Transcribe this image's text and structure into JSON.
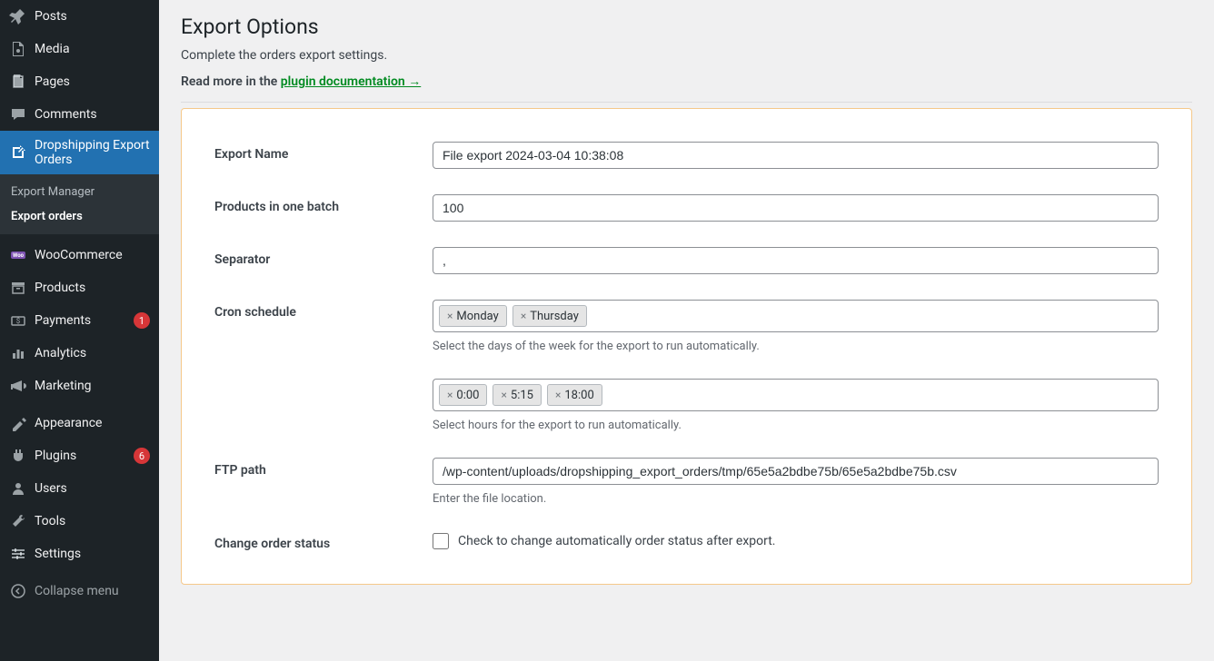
{
  "sidebar": {
    "items": [
      {
        "label": "Posts",
        "icon": "pushpin"
      },
      {
        "label": "Media",
        "icon": "media"
      },
      {
        "label": "Pages",
        "icon": "pages"
      },
      {
        "label": "Comments",
        "icon": "comments"
      },
      {
        "label": "Dropshipping Export Orders",
        "icon": "export",
        "active": true
      },
      {
        "label": "WooCommerce",
        "icon": "woo"
      },
      {
        "label": "Products",
        "icon": "archive"
      },
      {
        "label": "Payments",
        "icon": "payments",
        "badge": "1"
      },
      {
        "label": "Analytics",
        "icon": "analytics"
      },
      {
        "label": "Marketing",
        "icon": "marketing"
      },
      {
        "label": "Appearance",
        "icon": "appearance"
      },
      {
        "label": "Plugins",
        "icon": "plugins",
        "badge": "6"
      },
      {
        "label": "Users",
        "icon": "users"
      },
      {
        "label": "Tools",
        "icon": "tools"
      },
      {
        "label": "Settings",
        "icon": "settings"
      }
    ],
    "submenu": {
      "items": [
        "Export Manager",
        "Export orders"
      ],
      "current": 1
    },
    "collapse": "Collapse menu"
  },
  "page": {
    "title": "Export Options",
    "subtitle": "Complete the orders export settings.",
    "doc_prefix": "Read more in the ",
    "doc_link": "plugin documentation →"
  },
  "form": {
    "export_name": {
      "label": "Export Name",
      "value": "File export 2024-03-04 10:38:08"
    },
    "batch": {
      "label": "Products in one batch",
      "value": "100"
    },
    "separator": {
      "label": "Separator",
      "value": ","
    },
    "cron_days": {
      "label": "Cron schedule",
      "tags": [
        "Monday",
        "Thursday"
      ],
      "helper": "Select the days of the week for the export to run automatically."
    },
    "cron_hours": {
      "tags": [
        "0:00",
        "5:15",
        "18:00"
      ],
      "helper": "Select hours for the export to run automatically."
    },
    "ftp": {
      "label": "FTP path",
      "value": "/wp-content/uploads/dropshipping_export_orders/tmp/65e5a2bdbe75b/65e5a2bdbe75b.csv",
      "helper": "Enter the file location."
    },
    "change_status": {
      "label": "Change order status",
      "cb_label": "Check to change automatically order status after export."
    }
  }
}
